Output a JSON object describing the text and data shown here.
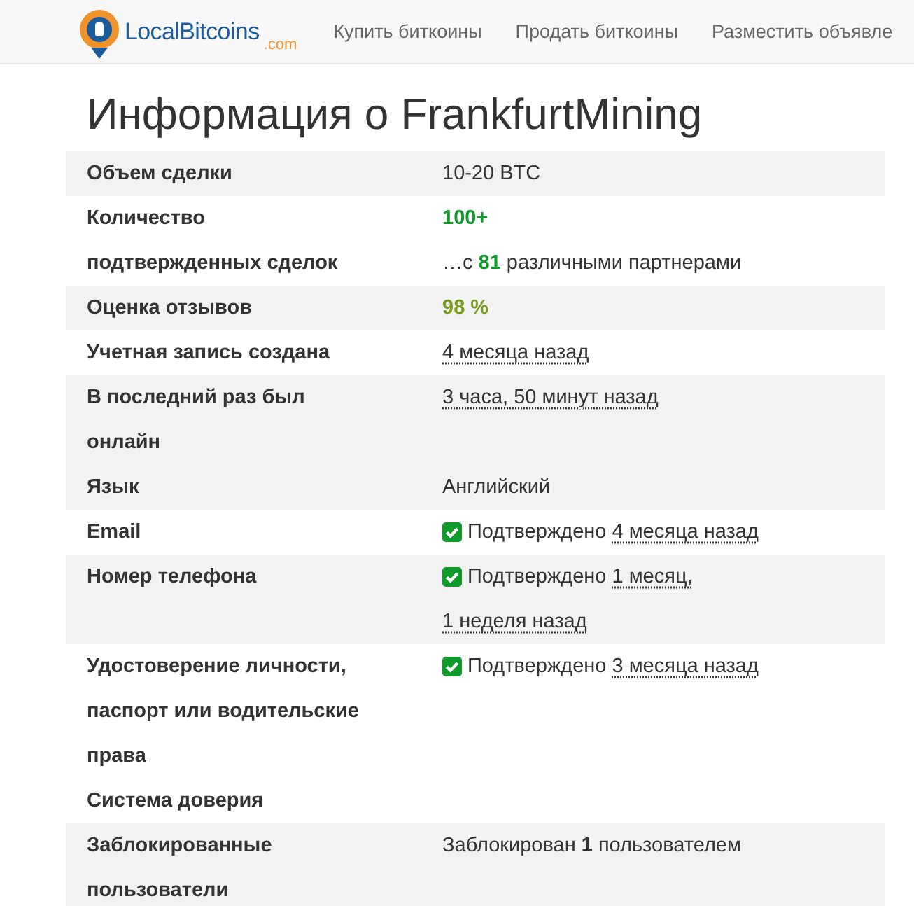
{
  "header": {
    "logo": {
      "name": "LocalBitcoins",
      "suffix": ".com"
    },
    "nav": [
      "Купить биткоины",
      "Продать биткоины",
      "Разместить объявле"
    ]
  },
  "title": "Информация о FrankfurtMining",
  "rows": [
    {
      "label": "Объем сделки",
      "shaded": true,
      "lines": [
        [
          {
            "kind": "plain",
            "text": "10-20 BTC"
          }
        ]
      ]
    },
    {
      "label": "Количество подтвержденных сделок",
      "shaded": false,
      "lines": [
        [
          {
            "kind": "good",
            "text": "100+"
          }
        ],
        [
          {
            "kind": "plain",
            "text": "…с"
          },
          {
            "kind": "good",
            "text": "81"
          },
          {
            "kind": "plain",
            "text": "различными партнерами"
          }
        ]
      ]
    },
    {
      "label": "Оценка отзывов",
      "shaded": true,
      "lines": [
        [
          {
            "kind": "fair",
            "text": "98 %"
          }
        ]
      ]
    },
    {
      "label": "Учетная запись создана",
      "shaded": false,
      "lines": [
        [
          {
            "kind": "time",
            "text": "4 месяца назад"
          }
        ]
      ]
    },
    {
      "label": "В последний раз был онлайн",
      "shaded": true,
      "lines": [
        [
          {
            "kind": "time",
            "text": "3 часа, 50 минут назад"
          }
        ]
      ]
    },
    {
      "label": "Язык",
      "shaded": true,
      "lines": [
        [
          {
            "kind": "plain",
            "text": "Английский"
          }
        ]
      ]
    },
    {
      "label": "Email",
      "shaded": false,
      "lines": [
        [
          {
            "kind": "verified",
            "text": "Подтверждено"
          },
          {
            "kind": "time",
            "text": "4 месяца назад"
          }
        ]
      ]
    },
    {
      "label": "Номер телефона",
      "shaded": true,
      "lines": [
        [
          {
            "kind": "verified",
            "text": "Подтверждено"
          },
          {
            "kind": "time",
            "text": "1 месяц,"
          }
        ],
        [
          {
            "kind": "time",
            "text": "1 неделя назад"
          }
        ]
      ]
    },
    {
      "label": "Удостоверение личности, паспорт или водительские права",
      "shaded": false,
      "lines": [
        [
          {
            "kind": "verified",
            "text": "Подтверждено"
          },
          {
            "kind": "time",
            "text": "3 месяца назад"
          }
        ]
      ]
    },
    {
      "label": "Система доверия",
      "shaded": false,
      "lines": []
    },
    {
      "label": "Заблокированные пользователи",
      "shaded": true,
      "lines": [
        [
          {
            "kind": "plain",
            "text": "Заблокирован"
          },
          {
            "kind": "bold",
            "text": "1"
          },
          {
            "kind": "plain",
            "text": "пользователем"
          }
        ]
      ]
    }
  ]
}
